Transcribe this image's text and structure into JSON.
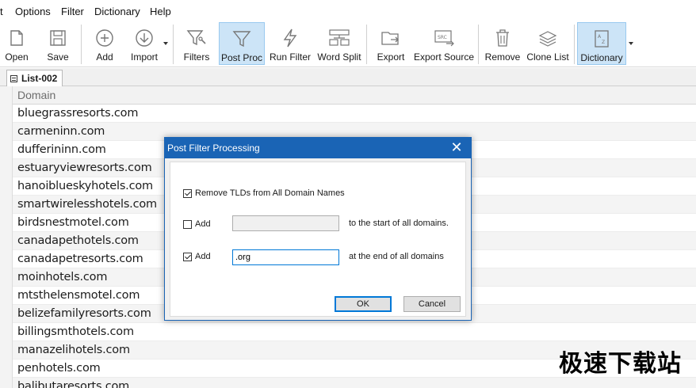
{
  "menu": [
    "t",
    "Options",
    "Filter",
    "Dictionary",
    "Help"
  ],
  "toolbar": {
    "open": "Open",
    "save": "Save",
    "add": "Add",
    "import": "Import",
    "filters": "Filters",
    "post_proc": "Post Proc",
    "run_filter": "Run Filter",
    "word_split": "Word Split",
    "export": "Export",
    "export_source": "Export Source",
    "remove": "Remove",
    "clone_list": "Clone List",
    "dictionary": "Dictionary",
    "active_color": "#cce4f7"
  },
  "tab": {
    "label": "List-002"
  },
  "grid": {
    "column_header": "Domain",
    "rows": [
      "bluegrassresorts.com",
      "carmeninn.com",
      "dufferininn.com",
      "estuaryviewresorts.com",
      "hanoiblueskyhotels.com",
      "smartwirelesshotels.com",
      "birdsnestmotel.com",
      "canadapethotels.com",
      "canadapetresorts.com",
      "moinhotels.com",
      "mtsthelensmotel.com",
      "belizefamilyresorts.com",
      "billingsmthotels.com",
      "manazelihotels.com",
      "penhotels.com",
      "balibutaresorts.com"
    ]
  },
  "dialog": {
    "title": "Post Filter Processing",
    "title_bar_color": "#1a64b5",
    "remove_tlds_label": "Remove TLDs from All Domain Names",
    "remove_tlds_checked": true,
    "prefix_label": "Add",
    "prefix_checked": false,
    "prefix_value": "",
    "prefix_suffix_text": "to the start of all domains.",
    "suffix_label": "Add",
    "suffix_checked": true,
    "suffix_value": ".org",
    "suffix_suffix_text": "at the end of all domains",
    "ok": "OK",
    "cancel": "Cancel"
  },
  "watermark": "极速下载站"
}
